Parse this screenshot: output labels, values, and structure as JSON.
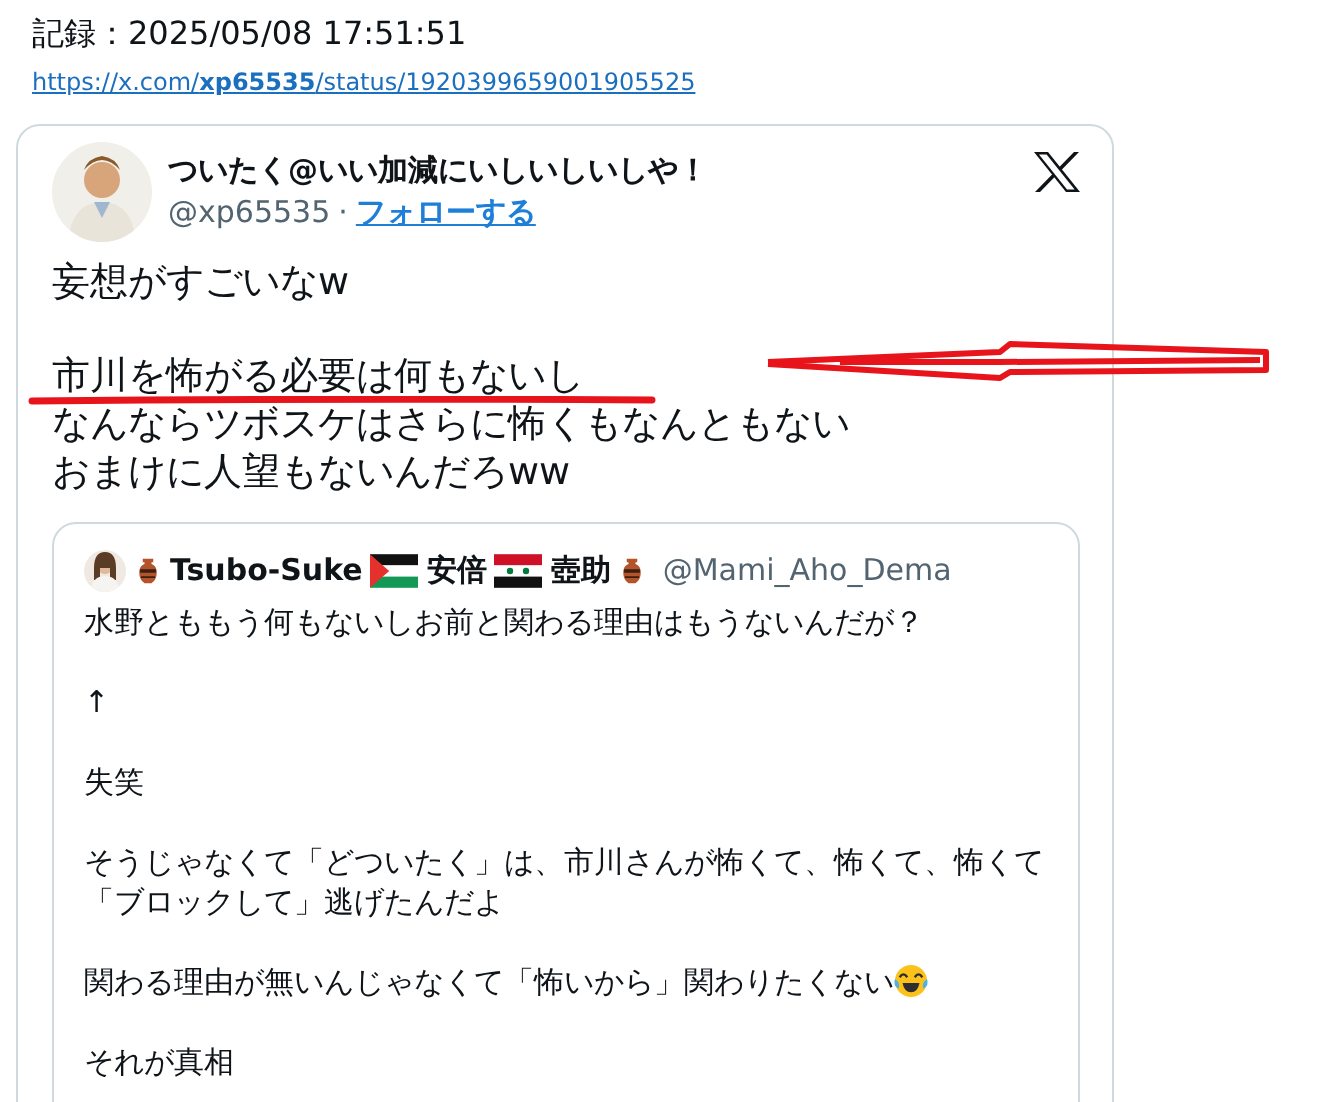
{
  "record": {
    "label": "記録：2025/05/08 17:51:51",
    "link": "https://x.com/**xp65535**/status/1920399659001905525"
  },
  "tweet": {
    "author": "ついたく@いい加減にいしいしいしや！",
    "handle": "@xp65535",
    "separator": "·",
    "follow": "フォローする",
    "paragraphs": [
      {
        "lines": [
          "妄想がすごいなw"
        ]
      },
      {
        "lines": [
          "市川を怖がる必要は何もないし",
          "なんならツボスケはさらに怖くもなんともない",
          "おまけに人望もないんだろww"
        ]
      }
    ],
    "quote": {
      "author_parts": [
        {
          "kind": "amphora"
        },
        {
          "kind": "text",
          "text": "Tsubo-Suke"
        },
        {
          "kind": "flag-palestine"
        },
        {
          "kind": "text",
          "text": "安倍"
        },
        {
          "kind": "flag-syria"
        },
        {
          "kind": "text",
          "text": "壺助"
        },
        {
          "kind": "amphora"
        }
      ],
      "handle": "@Mami_Aho_Dema",
      "paragraphs": [
        {
          "kind": "plain",
          "lines": [
            "水野とももう何もないしお前と関わる理由はもうないんだが？"
          ]
        },
        {
          "kind": "plain",
          "lines": [
            "↑"
          ]
        },
        {
          "kind": "plain",
          "lines": [
            "失笑"
          ]
        },
        {
          "kind": "plain",
          "lines": [
            "そうじゃなくて「どついたく」は、市川さんが怖くて、怖くて、怖くて",
            "「ブロックして」逃げたんだよ"
          ]
        },
        {
          "kind": "laughing-end",
          "lines": [
            "関わる理由が無いんじゃなくて「怖いから」関わりたくない"
          ]
        },
        {
          "kind": "plain",
          "lines": [
            "それが真相"
          ]
        }
      ]
    }
  },
  "annotations": {
    "underline": true,
    "arrow": true
  }
}
